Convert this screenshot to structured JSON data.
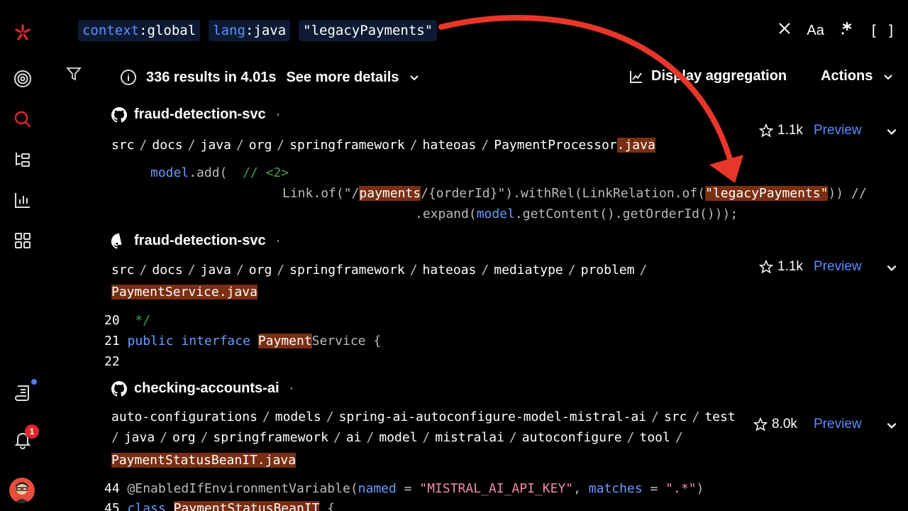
{
  "search": {
    "chips": [
      {
        "key": "context",
        "value": "global"
      },
      {
        "key": "lang",
        "value": "java"
      },
      {
        "key": "",
        "value": "\"legacyPayments\""
      }
    ]
  },
  "toolbar": {
    "results_count": "336 results in 4.01s",
    "see_more": "See more details",
    "display_aggregation": "Display aggregation",
    "actions": "Actions",
    "font_toggle": "Aa",
    "brackets": "[ ]"
  },
  "results": [
    {
      "repo": "fraud-detection-svc",
      "stars": "1.1k",
      "preview": "Preview",
      "path": [
        "src",
        "docs",
        "java",
        "org",
        "springframework",
        "hateoas",
        "PaymentProcessor"
      ],
      "ext": ".java",
      "code": {
        "line1_fn": "model",
        "line1_rest": ".add(",
        "line1_comment": "// <2>",
        "line2_a": "Link",
        "line2_b": ".of(\"/",
        "line2_hl": "payments",
        "line2_c": "/{orderId}\").withRel(",
        "line2_d": "LinkRelation",
        "line2_e": ".of(",
        "line2_hl2": "\"legacyPayments\"",
        "line2_f": ")) //",
        "line3_a": ".expand(",
        "line3_b": "model",
        "line3_c": ".getContent().getOrderId()));"
      }
    },
    {
      "repo": "fraud-detection-svc",
      "stars": "1.1k",
      "preview": "Preview",
      "path": [
        "src",
        "docs",
        "java",
        "org",
        "springframework",
        "hateoas",
        "mediatype",
        "problem",
        ""
      ],
      "file_hl": "PaymentService",
      "ext": ".java",
      "lines": [
        {
          "num": "20",
          "text": " */"
        },
        {
          "num": "21",
          "kw1": "public",
          "kw2": "interface",
          "hl": "Payment",
          "rest": "Service {"
        },
        {
          "num": "22",
          "text": ""
        }
      ]
    },
    {
      "repo": "checking-accounts-ai",
      "stars": "8.0k",
      "preview": "Preview",
      "path_line1": [
        "auto-configurations",
        "models",
        "spring-ai-autoconfigure-model-mistral-ai",
        "src",
        "test"
      ],
      "path_line2": [
        "java",
        "org",
        "springframework",
        "ai",
        "model",
        "mistralai",
        "autoconfigure",
        "tool",
        ""
      ],
      "file_hl": "PaymentStatusBeanIT",
      "ext": ".java",
      "lines": [
        {
          "num": "44",
          "ann": "@EnabledIfEnvironmentVariable",
          "p1": "(",
          "named": "named",
          "eq": " = ",
          "s1": "\"MISTRAL_AI_API_KEY\"",
          "comma": ", ",
          "matches": "matches",
          "eq2": " = ",
          "s2": "\".*\"",
          "close": ")"
        },
        {
          "num": "45",
          "kw": "class",
          "hl": "PaymentStatusBeanIT",
          "rest": " {"
        }
      ]
    }
  ],
  "sidebar": {
    "notification_count": "1"
  },
  "colors": {
    "accent": "#e0262b",
    "link": "#5b8cff",
    "highlight": "#7a2e12",
    "arrow": "#e8372a"
  }
}
